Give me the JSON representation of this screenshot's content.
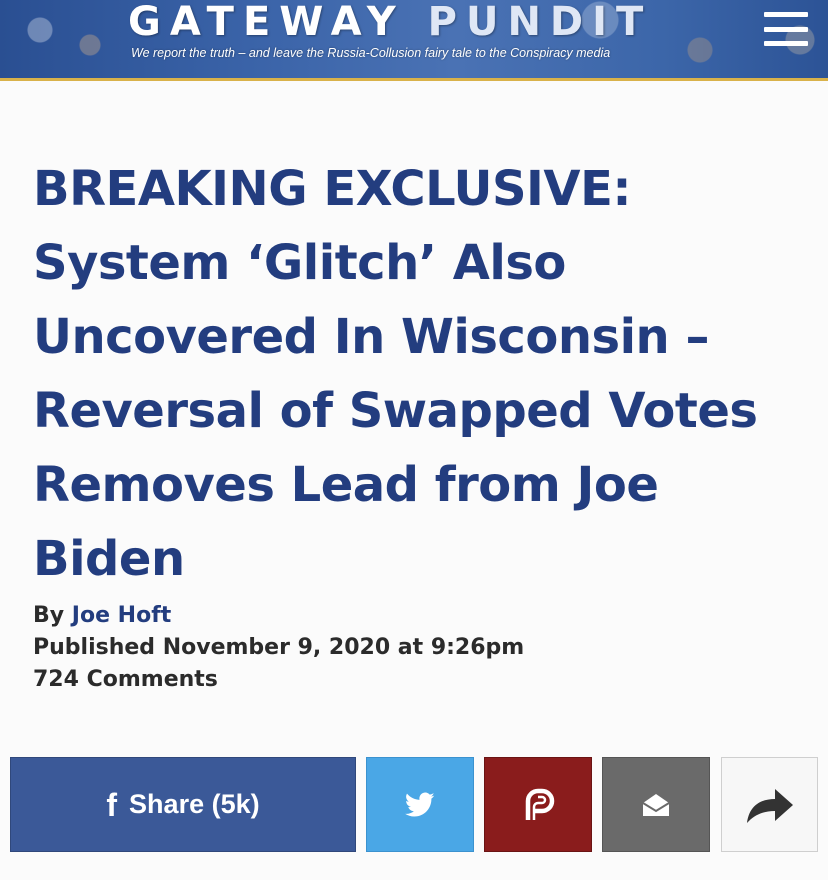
{
  "header": {
    "brand_left": "GATEWAY",
    "brand_right": "PUNDIT",
    "tagline": "We report the truth – and leave the Russia-Collusion fairy tale to the Conspiracy media",
    "menu_icon": "hamburger-menu-icon",
    "accent_color": "#d9b24a"
  },
  "article": {
    "headline": "BREAKING EXCLUSIVE: System ‘Glitch’ Also Uncovered In Wisconsin – Reversal of Swapped Votes Removes Lead from Joe Biden",
    "by_label": "By",
    "author": "Joe Hoft",
    "published": "Published November 9, 2020 at 9:26pm",
    "comments": "724 Comments",
    "headline_color": "#233d7f"
  },
  "share_bar": {
    "facebook_icon_text": "f",
    "facebook_label": "Share (5k)",
    "facebook_color": "#3b5998",
    "twitter_icon": "twitter-bird-icon",
    "twitter_color": "#4aa7e6",
    "parler_icon": "parler-icon",
    "parler_color": "#8a1c1c",
    "email_icon": "envelope-open-icon",
    "email_color": "#6a6a6a",
    "more_icon": "share-arrow-icon"
  }
}
